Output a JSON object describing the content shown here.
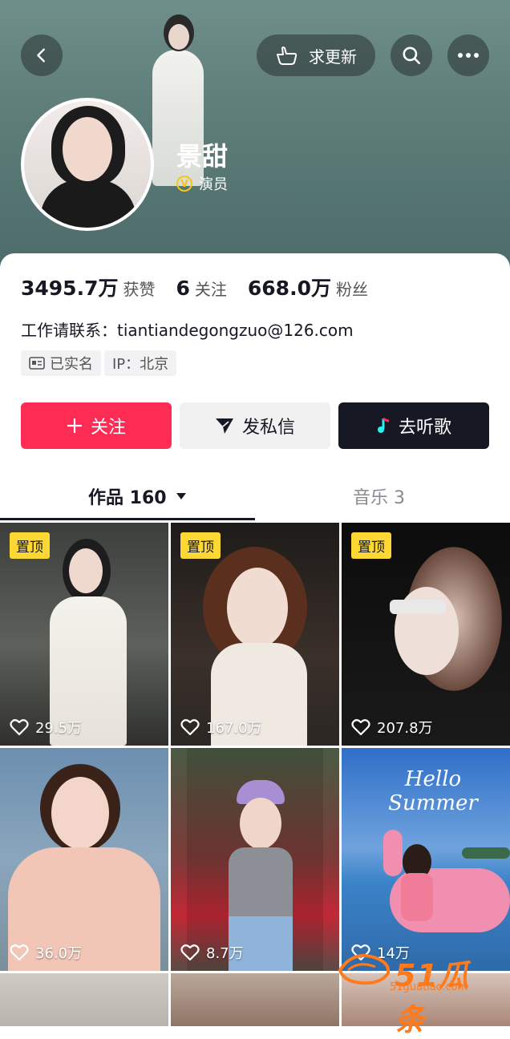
{
  "header": {
    "back_icon": "chevron-left-icon",
    "update_label": "求更新",
    "update_icon": "pointing-hand-icon",
    "search_icon": "search-icon",
    "more_icon": "more-dots-icon"
  },
  "profile": {
    "name": "景甜",
    "verified_label": "演员",
    "verified_icon": "v-badge-icon"
  },
  "stats": {
    "likes_value": "3495.7万",
    "likes_label": "获赞",
    "following_value": "6",
    "following_label": "关注",
    "followers_value": "668.0万",
    "followers_label": "粉丝"
  },
  "bio": "工作请联系：tiantiandegongzuo@126.com",
  "tags": {
    "verified_name": "已实名",
    "ip": "IP：北京"
  },
  "actions": {
    "follow_label": "关注",
    "message_label": "发私信",
    "music_label": "去听歌"
  },
  "tabs": {
    "works_label": "作品 160",
    "music_label": "音乐 3"
  },
  "videos": [
    {
      "pinned": "置顶",
      "likes": "29.5万"
    },
    {
      "pinned": "置顶",
      "likes": "167.0万"
    },
    {
      "pinned": "置顶",
      "likes": "207.8万"
    },
    {
      "pinned": "",
      "likes": "36.0万"
    },
    {
      "pinned": "",
      "likes": "8.7万"
    },
    {
      "pinned": "",
      "likes": "14万"
    }
  ],
  "summer_text": "Hello Summer",
  "watermark": {
    "brand": "51瓜条",
    "url": "51guatiao.com"
  },
  "colors": {
    "accent": "#fe2c55",
    "pin": "#fdd835",
    "dark": "#161823"
  }
}
